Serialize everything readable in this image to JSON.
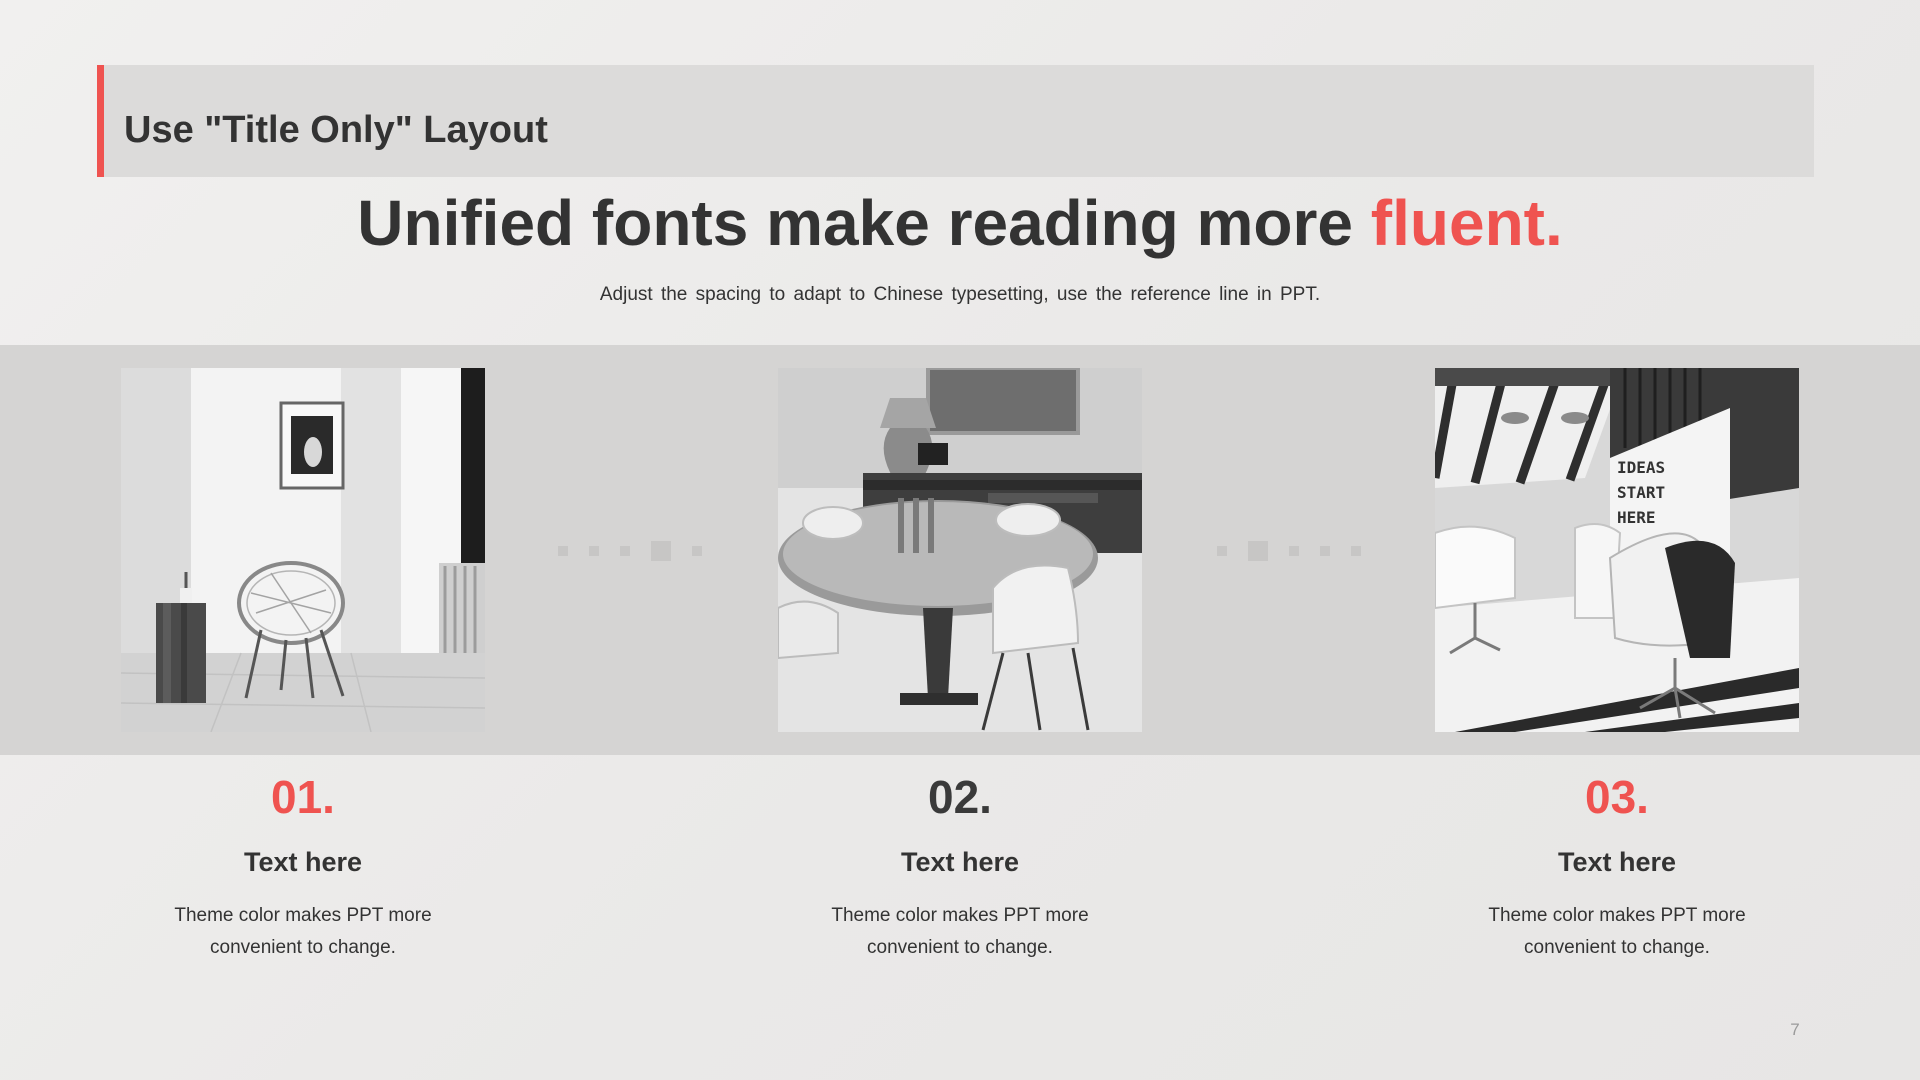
{
  "header": {
    "title": "Use \"Title Only\" Layout"
  },
  "headline": {
    "main": "Unified fonts make reading more ",
    "accent": "fluent."
  },
  "subline": "Adjust the spacing to adapt to Chinese typesetting, use the reference line in PPT.",
  "sign_text": [
    "IDEAS",
    "START",
    "HERE"
  ],
  "items": [
    {
      "number": "01.",
      "title": "Text here",
      "line1": "Theme color makes PPT more",
      "line2": "convenient  to change."
    },
    {
      "number": "02.",
      "title": "Text here",
      "line1": "Theme color makes PPT more",
      "line2": "convenient  to change."
    },
    {
      "number": "03.",
      "title": "Text here",
      "line1": "Theme color makes PPT more",
      "line2": "convenient  to change."
    }
  ],
  "page_number": "7",
  "colors": {
    "accent": "#ef5350",
    "dark_text": "#333333",
    "band": "#d5d4d3",
    "header_bar": "#dcdbda"
  }
}
